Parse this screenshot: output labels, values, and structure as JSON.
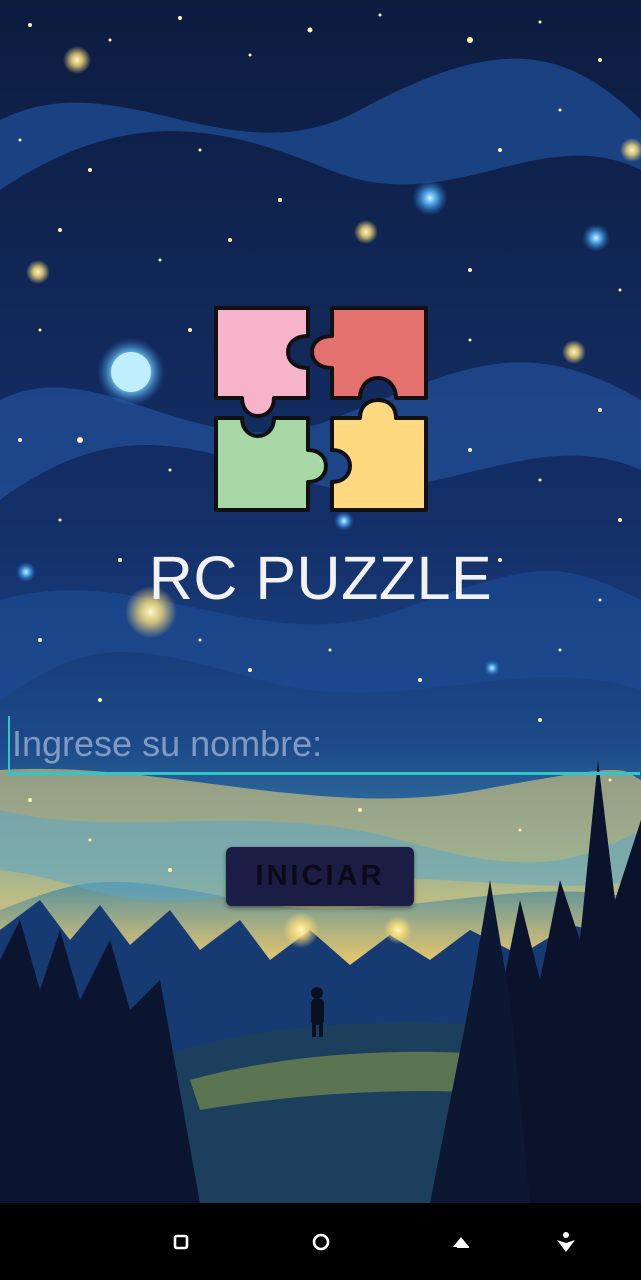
{
  "app": {
    "title": "RC PUZZLE",
    "logo_icon": "puzzle-pieces-icon"
  },
  "form": {
    "name_placeholder": "Ingrese su nombre:",
    "name_value": "",
    "start_label": "INICIAR"
  },
  "nav_bar": {
    "recents_icon": "recents-icon",
    "home_icon": "home-icon",
    "back_icon": "back-icon",
    "assist_icon": "accessibility-icon"
  },
  "colors": {
    "accent": "#2fc8c8",
    "button_bg": "#1b1d45",
    "title_text": "#f2f2f2",
    "piece_pink": "#f7b3c9",
    "piece_red": "#e4716e",
    "piece_green": "#a8d8a6",
    "piece_yellow": "#ffd980"
  }
}
